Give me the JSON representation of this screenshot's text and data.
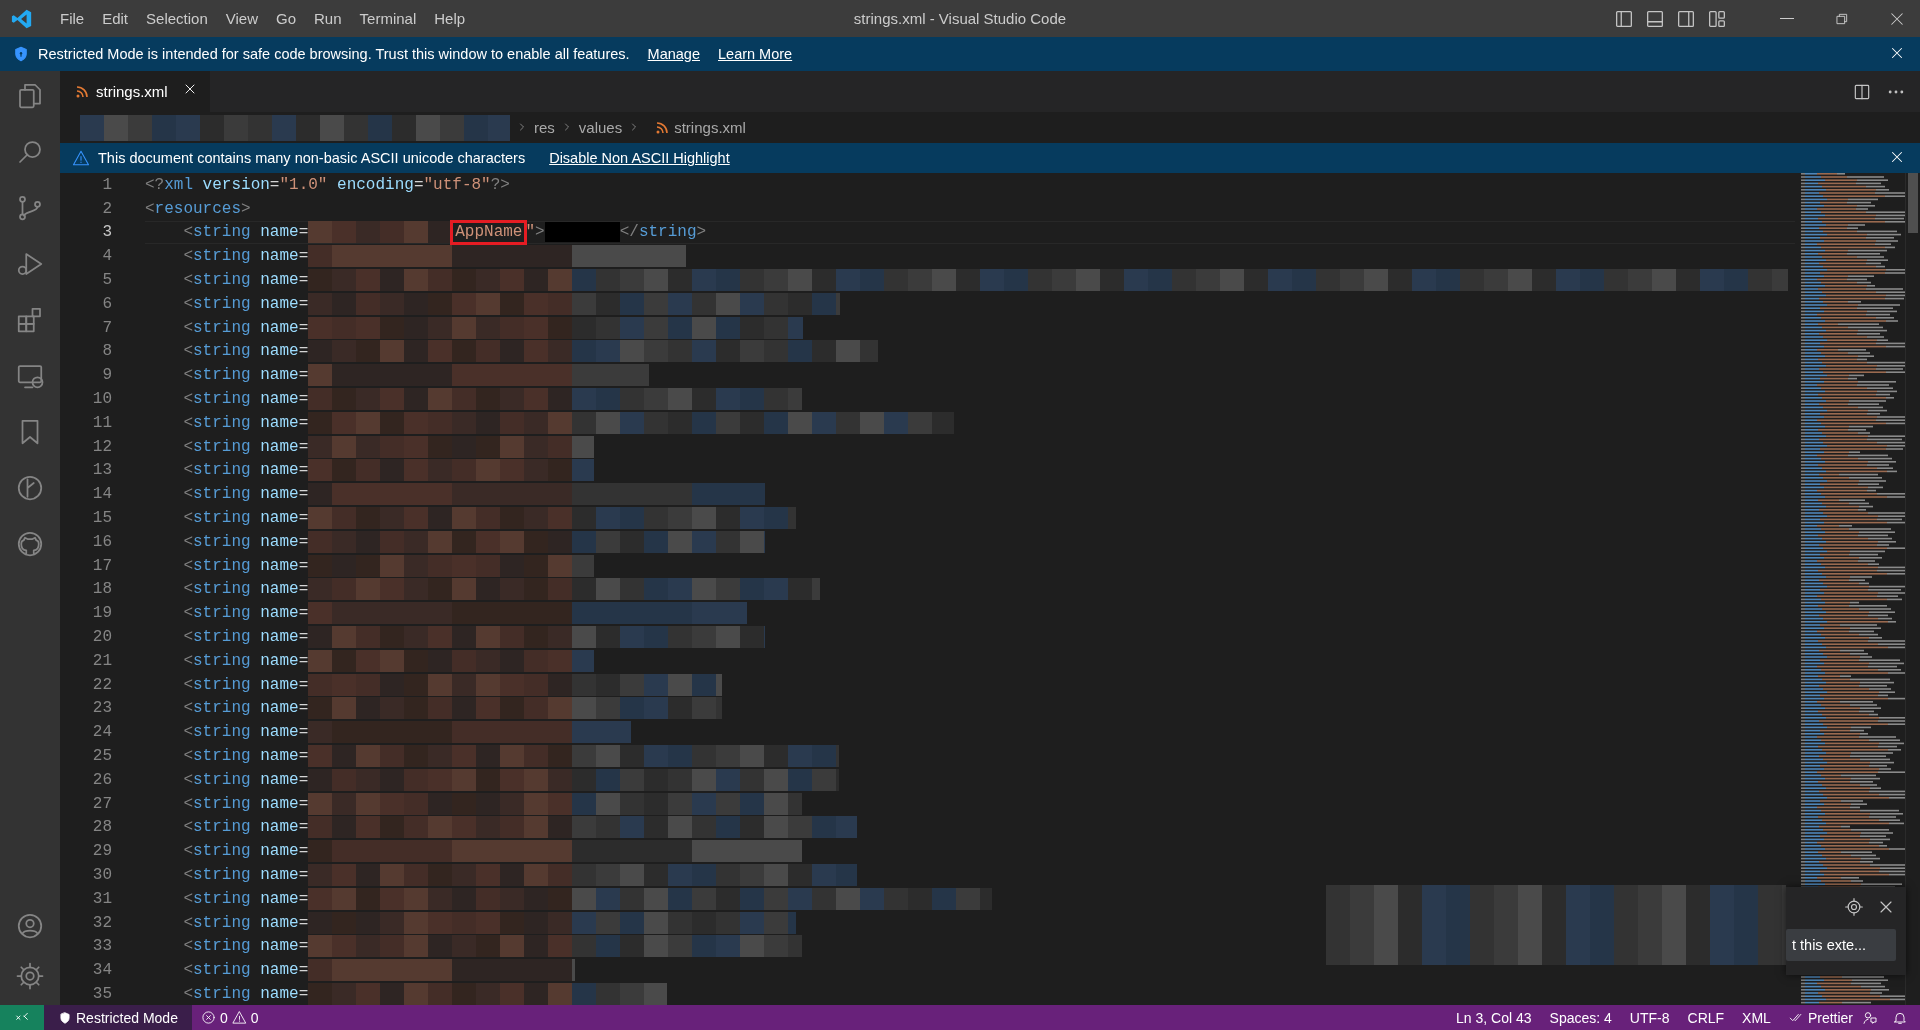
{
  "menu": [
    "File",
    "Edit",
    "Selection",
    "View",
    "Go",
    "Run",
    "Terminal",
    "Help"
  ],
  "window_title": "strings.xml - Visual Studio Code",
  "restricted_banner": {
    "message": "Restricted Mode is intended for safe code browsing. Trust this window to enable all features.",
    "links": [
      "Manage",
      "Learn More"
    ]
  },
  "tabs": [
    {
      "label": "strings.xml",
      "selected": true
    }
  ],
  "breadcrumb": [
    "res",
    "values",
    "strings.xml"
  ],
  "ascii_banner": {
    "message": "This document contains many non-basic ASCII unicode characters",
    "action": "Disable Non ASCII Highlight"
  },
  "lines": [
    {
      "number": "1",
      "current": false,
      "tokens": [
        {
          "kind": "punct",
          "text": "<?"
        },
        {
          "kind": "tag",
          "text": "xml"
        },
        {
          "kind": "attr",
          "text": " version"
        },
        {
          "kind": "op",
          "text": "="
        },
        {
          "kind": "string",
          "text": "\"1.0\""
        },
        {
          "kind": "attr",
          "text": " encoding"
        },
        {
          "kind": "op",
          "text": "="
        },
        {
          "kind": "string",
          "text": "\"utf-8\""
        },
        {
          "kind": "punct",
          "text": "?>"
        }
      ]
    },
    {
      "number": "2",
      "current": false,
      "tokens": [
        {
          "kind": "punct",
          "text": "<"
        },
        {
          "kind": "tag",
          "text": "resources"
        },
        {
          "kind": "punct",
          "text": ">"
        }
      ]
    },
    {
      "number": "3",
      "current": true,
      "tokens": [
        {
          "kind": "punct",
          "text": "    <"
        },
        {
          "kind": "tag",
          "text": "string"
        },
        {
          "kind": "attr",
          "text": " name"
        },
        {
          "kind": "op",
          "text": "="
        },
        {
          "kind": "redacted"
        },
        {
          "kind": "boxed",
          "text": "AppName"
        },
        {
          "kind": "string",
          "text": "\""
        },
        {
          "kind": "punct",
          "text": ">"
        },
        {
          "kind": "masked"
        },
        {
          "kind": "punct",
          "text": "</"
        },
        {
          "kind": "tag",
          "text": "string"
        },
        {
          "kind": "punct",
          "text": ">"
        }
      ]
    },
    {
      "number": "4",
      "current": false,
      "tokens": [
        {
          "kind": "punct",
          "text": "    <"
        },
        {
          "kind": "tag",
          "text": "string"
        },
        {
          "kind": "attr",
          "text": " name"
        },
        {
          "kind": "op",
          "text": "="
        },
        {
          "kind": "redacted"
        }
      ]
    },
    {
      "number": "5",
      "current": false,
      "tokens": [
        {
          "kind": "punct",
          "text": "    <"
        },
        {
          "kind": "tag",
          "text": "string"
        },
        {
          "kind": "attr",
          "text": " name"
        },
        {
          "kind": "op",
          "text": "="
        },
        {
          "kind": "redacted"
        }
      ]
    },
    {
      "number": "6",
      "current": false,
      "tokens": [
        {
          "kind": "punct",
          "text": "    <"
        },
        {
          "kind": "tag",
          "text": "string"
        },
        {
          "kind": "attr",
          "text": " name"
        },
        {
          "kind": "op",
          "text": "="
        },
        {
          "kind": "redacted"
        }
      ]
    },
    {
      "number": "7",
      "current": false,
      "tokens": [
        {
          "kind": "punct",
          "text": "    <"
        },
        {
          "kind": "tag",
          "text": "string"
        },
        {
          "kind": "attr",
          "text": " name"
        },
        {
          "kind": "op",
          "text": "="
        },
        {
          "kind": "redacted"
        }
      ]
    },
    {
      "number": "8",
      "current": false,
      "tokens": [
        {
          "kind": "punct",
          "text": "    <"
        },
        {
          "kind": "tag",
          "text": "string"
        },
        {
          "kind": "attr",
          "text": " name"
        },
        {
          "kind": "op",
          "text": "="
        },
        {
          "kind": "redacted"
        }
      ]
    },
    {
      "number": "9",
      "current": false,
      "tokens": [
        {
          "kind": "punct",
          "text": "    <"
        },
        {
          "kind": "tag",
          "text": "string"
        },
        {
          "kind": "attr",
          "text": " name"
        },
        {
          "kind": "op",
          "text": "="
        },
        {
          "kind": "redacted"
        }
      ]
    },
    {
      "number": "10",
      "current": false,
      "tokens": [
        {
          "kind": "punct",
          "text": "    <"
        },
        {
          "kind": "tag",
          "text": "string"
        },
        {
          "kind": "attr",
          "text": " name"
        },
        {
          "kind": "op",
          "text": "="
        },
        {
          "kind": "redacted"
        }
      ]
    },
    {
      "number": "11",
      "current": false,
      "tokens": [
        {
          "kind": "punct",
          "text": "    <"
        },
        {
          "kind": "tag",
          "text": "string"
        },
        {
          "kind": "attr",
          "text": " name"
        },
        {
          "kind": "op",
          "text": "="
        },
        {
          "kind": "redacted"
        }
      ]
    },
    {
      "number": "12",
      "current": false,
      "tokens": [
        {
          "kind": "punct",
          "text": "    <"
        },
        {
          "kind": "tag",
          "text": "string"
        },
        {
          "kind": "attr",
          "text": " name"
        },
        {
          "kind": "op",
          "text": "="
        },
        {
          "kind": "redacted"
        }
      ]
    },
    {
      "number": "13",
      "current": false,
      "tokens": [
        {
          "kind": "punct",
          "text": "    <"
        },
        {
          "kind": "tag",
          "text": "string"
        },
        {
          "kind": "attr",
          "text": " name"
        },
        {
          "kind": "op",
          "text": "="
        },
        {
          "kind": "redacted"
        }
      ]
    },
    {
      "number": "14",
      "current": false,
      "tokens": [
        {
          "kind": "punct",
          "text": "    <"
        },
        {
          "kind": "tag",
          "text": "string"
        },
        {
          "kind": "attr",
          "text": " name"
        },
        {
          "kind": "op",
          "text": "="
        },
        {
          "kind": "redacted"
        }
      ]
    },
    {
      "number": "15",
      "current": false,
      "tokens": [
        {
          "kind": "punct",
          "text": "    <"
        },
        {
          "kind": "tag",
          "text": "string"
        },
        {
          "kind": "attr",
          "text": " name"
        },
        {
          "kind": "op",
          "text": "="
        },
        {
          "kind": "redacted"
        }
      ]
    },
    {
      "number": "16",
      "current": false,
      "tokens": [
        {
          "kind": "punct",
          "text": "    <"
        },
        {
          "kind": "tag",
          "text": "string"
        },
        {
          "kind": "attr",
          "text": " name"
        },
        {
          "kind": "op",
          "text": "="
        },
        {
          "kind": "redacted"
        }
      ]
    },
    {
      "number": "17",
      "current": false,
      "tokens": [
        {
          "kind": "punct",
          "text": "    <"
        },
        {
          "kind": "tag",
          "text": "string"
        },
        {
          "kind": "attr",
          "text": " name"
        },
        {
          "kind": "op",
          "text": "="
        },
        {
          "kind": "redacted"
        }
      ]
    },
    {
      "number": "18",
      "current": false,
      "tokens": [
        {
          "kind": "punct",
          "text": "    <"
        },
        {
          "kind": "tag",
          "text": "string"
        },
        {
          "kind": "attr",
          "text": " name"
        },
        {
          "kind": "op",
          "text": "="
        },
        {
          "kind": "redacted"
        }
      ]
    },
    {
      "number": "19",
      "current": false,
      "tokens": [
        {
          "kind": "punct",
          "text": "    <"
        },
        {
          "kind": "tag",
          "text": "string"
        },
        {
          "kind": "attr",
          "text": " name"
        },
        {
          "kind": "op",
          "text": "="
        },
        {
          "kind": "redacted"
        }
      ]
    },
    {
      "number": "20",
      "current": false,
      "tokens": [
        {
          "kind": "punct",
          "text": "    <"
        },
        {
          "kind": "tag",
          "text": "string"
        },
        {
          "kind": "attr",
          "text": " name"
        },
        {
          "kind": "op",
          "text": "="
        },
        {
          "kind": "redacted"
        }
      ]
    },
    {
      "number": "21",
      "current": false,
      "tokens": [
        {
          "kind": "punct",
          "text": "    <"
        },
        {
          "kind": "tag",
          "text": "string"
        },
        {
          "kind": "attr",
          "text": " name"
        },
        {
          "kind": "op",
          "text": "="
        },
        {
          "kind": "redacted"
        }
      ]
    },
    {
      "number": "22",
      "current": false,
      "tokens": [
        {
          "kind": "punct",
          "text": "    <"
        },
        {
          "kind": "tag",
          "text": "string"
        },
        {
          "kind": "attr",
          "text": " name"
        },
        {
          "kind": "op",
          "text": "="
        },
        {
          "kind": "redacted"
        }
      ]
    },
    {
      "number": "23",
      "current": false,
      "tokens": [
        {
          "kind": "punct",
          "text": "    <"
        },
        {
          "kind": "tag",
          "text": "string"
        },
        {
          "kind": "attr",
          "text": " name"
        },
        {
          "kind": "op",
          "text": "="
        },
        {
          "kind": "redacted"
        }
      ]
    },
    {
      "number": "24",
      "current": false,
      "tokens": [
        {
          "kind": "punct",
          "text": "    <"
        },
        {
          "kind": "tag",
          "text": "string"
        },
        {
          "kind": "attr",
          "text": " name"
        },
        {
          "kind": "op",
          "text": "="
        },
        {
          "kind": "redacted"
        }
      ]
    },
    {
      "number": "25",
      "current": false,
      "tokens": [
        {
          "kind": "punct",
          "text": "    <"
        },
        {
          "kind": "tag",
          "text": "string"
        },
        {
          "kind": "attr",
          "text": " name"
        },
        {
          "kind": "op",
          "text": "="
        },
        {
          "kind": "redacted"
        }
      ]
    },
    {
      "number": "26",
      "current": false,
      "tokens": [
        {
          "kind": "punct",
          "text": "    <"
        },
        {
          "kind": "tag",
          "text": "string"
        },
        {
          "kind": "attr",
          "text": " name"
        },
        {
          "kind": "op",
          "text": "="
        },
        {
          "kind": "redacted"
        }
      ]
    },
    {
      "number": "27",
      "current": false,
      "tokens": [
        {
          "kind": "punct",
          "text": "    <"
        },
        {
          "kind": "tag",
          "text": "string"
        },
        {
          "kind": "attr",
          "text": " name"
        },
        {
          "kind": "op",
          "text": "="
        },
        {
          "kind": "redacted"
        }
      ]
    },
    {
      "number": "28",
      "current": false,
      "tokens": [
        {
          "kind": "punct",
          "text": "    <"
        },
        {
          "kind": "tag",
          "text": "string"
        },
        {
          "kind": "attr",
          "text": " name"
        },
        {
          "kind": "op",
          "text": "="
        },
        {
          "kind": "redacted"
        }
      ]
    },
    {
      "number": "29",
      "current": false,
      "tokens": [
        {
          "kind": "punct",
          "text": "    <"
        },
        {
          "kind": "tag",
          "text": "string"
        },
        {
          "kind": "attr",
          "text": " name"
        },
        {
          "kind": "op",
          "text": "="
        },
        {
          "kind": "redacted"
        }
      ]
    },
    {
      "number": "30",
      "current": false,
      "tokens": [
        {
          "kind": "punct",
          "text": "    <"
        },
        {
          "kind": "tag",
          "text": "string"
        },
        {
          "kind": "attr",
          "text": " name"
        },
        {
          "kind": "op",
          "text": "="
        },
        {
          "kind": "redacted"
        }
      ]
    },
    {
      "number": "31",
      "current": false,
      "tokens": [
        {
          "kind": "punct",
          "text": "    <"
        },
        {
          "kind": "tag",
          "text": "string"
        },
        {
          "kind": "attr",
          "text": " name"
        },
        {
          "kind": "op",
          "text": "="
        },
        {
          "kind": "redacted"
        }
      ]
    },
    {
      "number": "32",
      "current": false,
      "tokens": [
        {
          "kind": "punct",
          "text": "    <"
        },
        {
          "kind": "tag",
          "text": "string"
        },
        {
          "kind": "attr",
          "text": " name"
        },
        {
          "kind": "op",
          "text": "="
        },
        {
          "kind": "redacted"
        }
      ]
    },
    {
      "number": "33",
      "current": false,
      "tokens": [
        {
          "kind": "punct",
          "text": "    <"
        },
        {
          "kind": "tag",
          "text": "string"
        },
        {
          "kind": "attr",
          "text": " name"
        },
        {
          "kind": "op",
          "text": "="
        },
        {
          "kind": "redacted"
        }
      ]
    },
    {
      "number": "34",
      "current": false,
      "tokens": [
        {
          "kind": "punct",
          "text": "    <"
        },
        {
          "kind": "tag",
          "text": "string"
        },
        {
          "kind": "attr",
          "text": " name"
        },
        {
          "kind": "op",
          "text": "="
        },
        {
          "kind": "redacted"
        }
      ]
    },
    {
      "number": "35",
      "current": false,
      "tokens": [
        {
          "kind": "punct",
          "text": "    <"
        },
        {
          "kind": "tag",
          "text": "string"
        },
        {
          "kind": "attr",
          "text": " name"
        },
        {
          "kind": "op",
          "text": "="
        },
        {
          "kind": "redacted"
        }
      ]
    }
  ],
  "notification": {
    "button": "t this exte..."
  },
  "status_bar": {
    "left": [
      {
        "kind": "restricted",
        "text": "Restricted Mode"
      },
      {
        "kind": "problems",
        "errors": "0",
        "warnings": "0"
      }
    ],
    "right": [
      {
        "kind": "text",
        "text": "Ln 3, Col 43"
      },
      {
        "kind": "text",
        "text": "Spaces: 4"
      },
      {
        "kind": "text",
        "text": "UTF-8"
      },
      {
        "kind": "text",
        "text": "CRLF"
      },
      {
        "kind": "text",
        "text": "XML"
      },
      {
        "kind": "prettier",
        "text": "Prettier"
      }
    ]
  }
}
